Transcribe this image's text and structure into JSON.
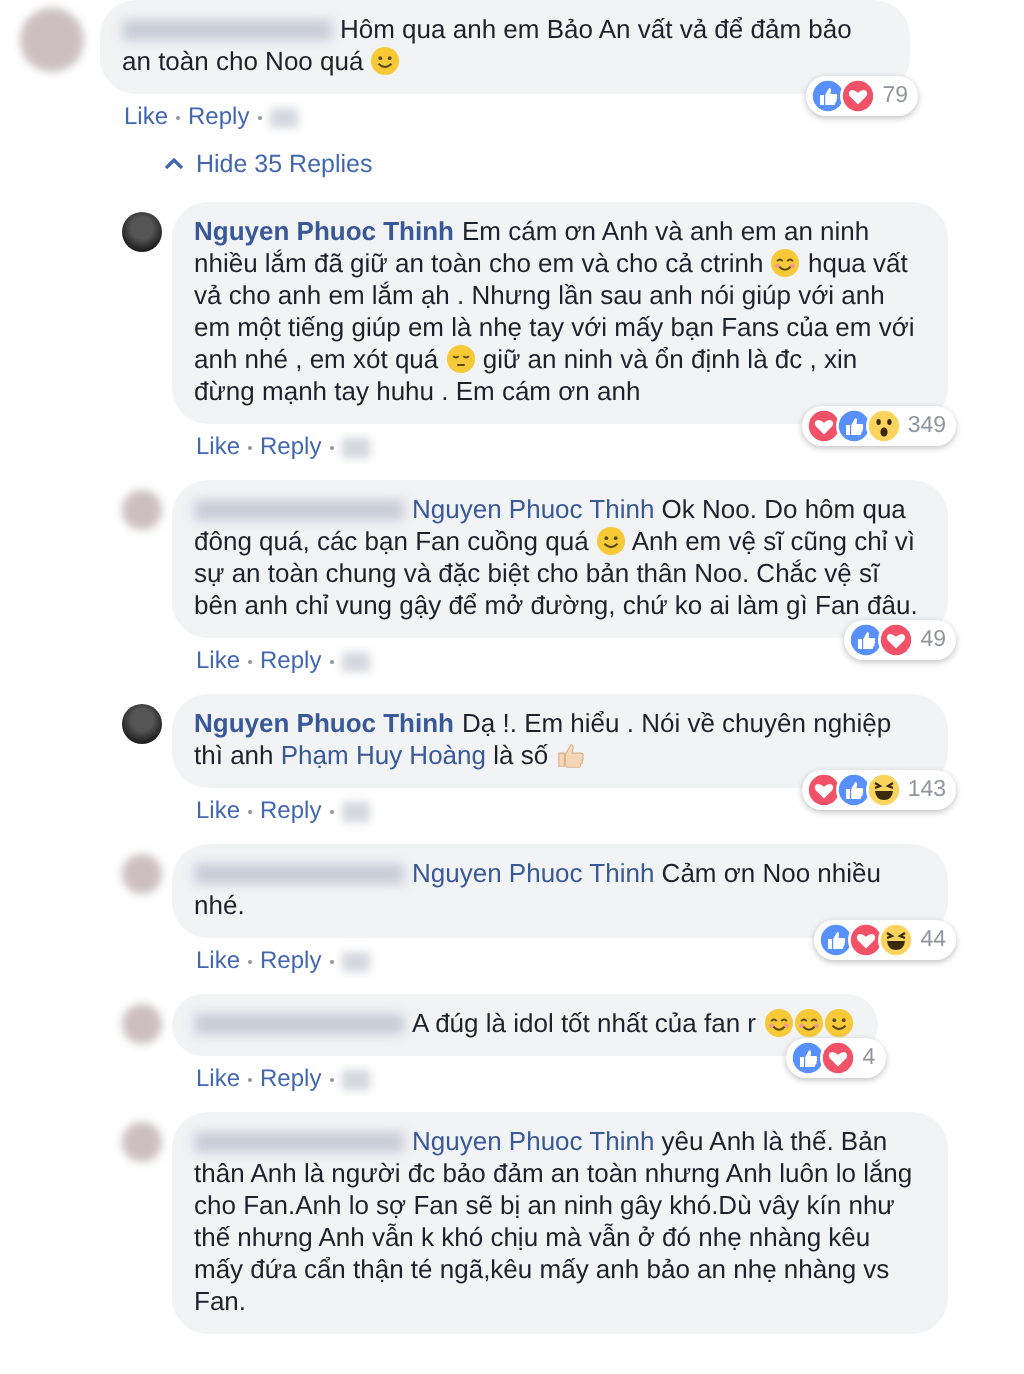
{
  "comment": {
    "blurred": true,
    "body": [
      {
        "kind": "text",
        "text": "Hôm qua anh em Bảo An vất vả để đảm bảo an toàn cho Noo quá "
      },
      {
        "kind": "smile"
      }
    ],
    "reactions": [
      {
        "kind": "like"
      },
      {
        "kind": "love"
      }
    ],
    "reaction_count": "79",
    "actions": [
      "Like",
      "Reply"
    ],
    "replies_toggle": {
      "label": "Hide 35 Replies",
      "expanded": true
    },
    "replies": [
      {
        "blurred": false,
        "author": "Nguyen Phuoc Thinh",
        "body": [
          {
            "kind": "text",
            "text": "Em cám ơn Anh và anh em an ninh nhiều lắm đã giữ an toàn cho em và cho cả ctrinh "
          },
          {
            "kind": "blush"
          },
          {
            "kind": "text",
            "text": " hqua vất vả cho anh em lắm ạh . Nhưng lần sau anh nói giúp với anh em một tiếng giúp em là nhẹ tay với mấy bạn Fans của em với anh nhé , em xót quá "
          },
          {
            "kind": "pensive"
          },
          {
            "kind": "text",
            "text": " giữ an ninh và ổn định là đc , xin đừng mạnh tay huhu . Em cám ơn anh"
          }
        ],
        "reactions": [
          {
            "kind": "love"
          },
          {
            "kind": "like"
          },
          {
            "kind": "wow"
          }
        ],
        "reaction_count": "349",
        "actions": [
          "Like",
          "Reply"
        ]
      },
      {
        "blurred": true,
        "body": [
          {
            "kind": "mention",
            "text": "Nguyen Phuoc Thinh"
          },
          {
            "kind": "text",
            "text": " Ok Noo. Do hôm qua đông quá, các bạn Fan cuồng quá "
          },
          {
            "kind": "smile"
          },
          {
            "kind": "text",
            "text": " Anh em vệ sĩ cũng chỉ vì sự an toàn chung và đặc biệt cho bản thân Noo. Chắc vệ sĩ bên anh chỉ vung gậy để mở đường, chứ ko ai làm gì Fan đâu."
          }
        ],
        "reactions": [
          {
            "kind": "like"
          },
          {
            "kind": "love"
          }
        ],
        "reaction_count": "49",
        "actions": [
          "Like",
          "Reply"
        ]
      },
      {
        "blurred": false,
        "author": "Nguyen Phuoc Thinh",
        "body": [
          {
            "kind": "text",
            "text": "Dạ !. Em hiểu . Nói về chuyên nghiệp thì anh "
          },
          {
            "kind": "mention",
            "text": "Phạm Huy Hoàng"
          },
          {
            "kind": "text",
            "text": " là số "
          },
          {
            "kind": "thumb"
          }
        ],
        "reactions": [
          {
            "kind": "love"
          },
          {
            "kind": "like"
          },
          {
            "kind": "haha"
          }
        ],
        "reaction_count": "143",
        "actions": [
          "Like",
          "Reply"
        ]
      },
      {
        "blurred": true,
        "body": [
          {
            "kind": "mention",
            "text": "Nguyen Phuoc Thinh"
          },
          {
            "kind": "text",
            "text": " Cảm ơn Noo nhiều nhé."
          }
        ],
        "reactions": [
          {
            "kind": "like"
          },
          {
            "kind": "love"
          },
          {
            "kind": "haha"
          }
        ],
        "reaction_count": "44",
        "actions": [
          "Like",
          "Reply"
        ]
      },
      {
        "blurred": true,
        "body": [
          {
            "kind": "text",
            "text": "A đúg là idol tốt nhất của fan r "
          },
          {
            "kind": "blush"
          },
          {
            "kind": "blush"
          },
          {
            "kind": "smile"
          }
        ],
        "reactions": [
          {
            "kind": "like"
          },
          {
            "kind": "love"
          }
        ],
        "reaction_count": "4",
        "actions": [
          "Like",
          "Reply"
        ]
      },
      {
        "blurred": true,
        "body": [
          {
            "kind": "mention",
            "text": "Nguyen Phuoc Thinh"
          },
          {
            "kind": "text",
            "text": " yêu Anh là thế. Bản thân Anh là người đc bảo đảm an toàn nhưng Anh luôn lo lắng cho Fan.Anh lo sợ Fan sẽ bị an ninh gây khó.Dù vây kín như thế nhưng Anh vẫn k khó chịu mà vẫn ở đó nhẹ nhàng kêu mấy đứa cẩn thận té ngã,kêu mấy anh bảo an nhẹ nhàng vs Fan."
          }
        ]
      }
    ]
  }
}
